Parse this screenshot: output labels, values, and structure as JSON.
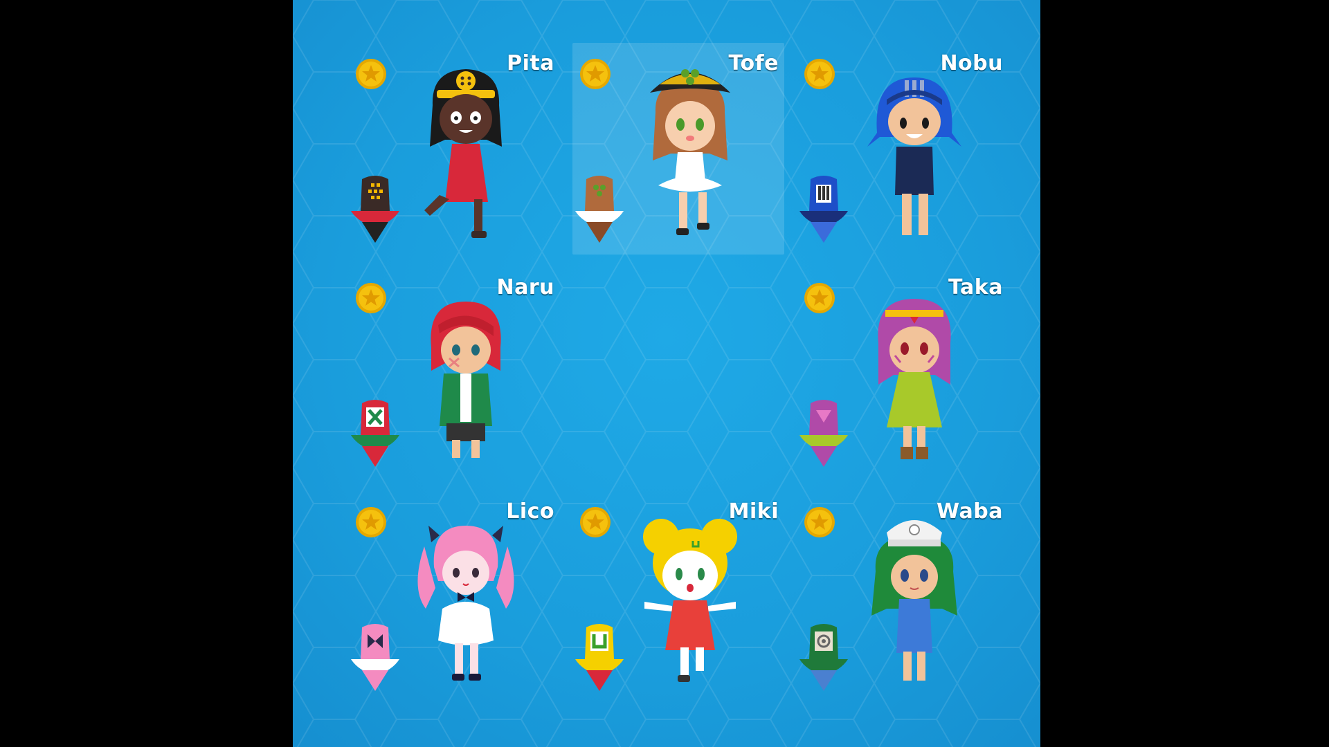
{
  "screen": "character-select",
  "colors": {
    "background": "#1a9ddc",
    "name_text": "#ffffff",
    "coin": "#f5c10e",
    "selected_highlight": "rgba(255,255,255,0.14)"
  },
  "characters": [
    {
      "name": "Pita",
      "selected": false,
      "icon": "coin-star-icon"
    },
    {
      "name": "Tofe",
      "selected": true,
      "icon": "coin-star-icon"
    },
    {
      "name": "Nobu",
      "selected": false,
      "icon": "coin-star-icon"
    },
    {
      "name": "Naru",
      "selected": false,
      "icon": "coin-star-icon"
    },
    {
      "name": "",
      "selected": false,
      "empty": true
    },
    {
      "name": "Taka",
      "selected": false,
      "icon": "coin-star-icon"
    },
    {
      "name": "Lico",
      "selected": false,
      "icon": "coin-star-icon"
    },
    {
      "name": "Miki",
      "selected": false,
      "icon": "coin-star-icon"
    },
    {
      "name": "Waba",
      "selected": false,
      "icon": "coin-star-icon"
    }
  ]
}
